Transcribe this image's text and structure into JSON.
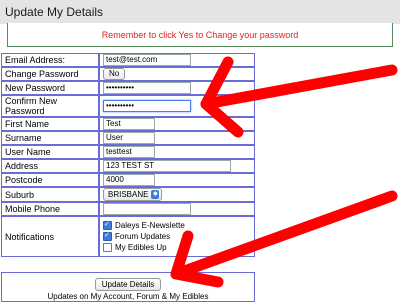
{
  "header": {
    "title": "Update My Details"
  },
  "notice": {
    "text": "Remember to click Yes to Change your password"
  },
  "fields": {
    "email": {
      "label": "Email Address:",
      "value": "test@test.com"
    },
    "change_password": {
      "label": "Change Password",
      "button": "No"
    },
    "new_password": {
      "label": "New Password",
      "value": "••••••••••"
    },
    "confirm_password": {
      "label": "Confirm New Password",
      "value": "••••••••••"
    },
    "first_name": {
      "label": "First Name",
      "value": "Test"
    },
    "surname": {
      "label": "Surname",
      "value": "User"
    },
    "user_name": {
      "label": "User Name",
      "value": "testtest"
    },
    "address": {
      "label": "Address",
      "value": "123 TEST ST"
    },
    "postcode": {
      "label": "Postcode",
      "value": "4000"
    },
    "suburb": {
      "label": "Suburb",
      "value": "BRISBANE"
    },
    "mobile": {
      "label": "Mobile Phone",
      "value": ""
    },
    "notifications": {
      "label": "Notifications",
      "options": [
        {
          "label": "Daleys E-Newslette",
          "checked": true
        },
        {
          "label": "Forum Updates",
          "checked": true
        },
        {
          "label": "My Edibles Up",
          "checked": false
        }
      ]
    }
  },
  "actions": {
    "update_label": "Update Details"
  },
  "footer": {
    "text": "Updates on My Account, Forum & My Edibles"
  },
  "colors": {
    "accent": "#3b7ee0",
    "notice_text": "#dd2222",
    "arrow": "#ff0000",
    "table_border": "#6b6bd6"
  }
}
